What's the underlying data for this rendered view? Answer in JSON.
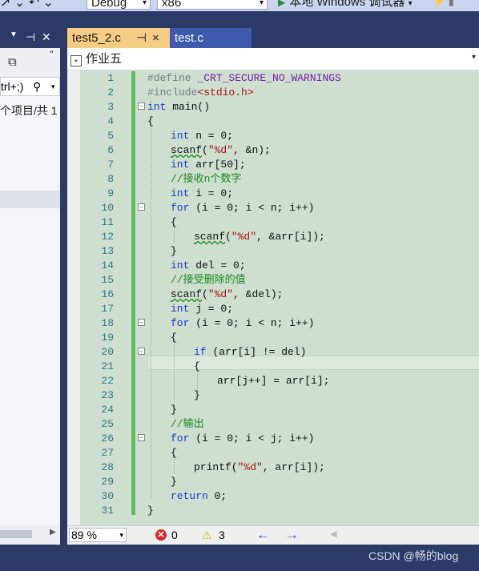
{
  "toolbar": {
    "config": "Debug",
    "platform": "x86",
    "run_label": "本地 Windows 调试器"
  },
  "left_panel": {
    "search_text": "trl+;)",
    "item_text": "个项目/共 1"
  },
  "tabs": [
    {
      "label": "test5_2.c",
      "pin": "⊣",
      "close": "×"
    },
    {
      "label": "test.c"
    }
  ],
  "nav": {
    "scope": "作业五"
  },
  "editor": {
    "line_numbers": [
      "1",
      "2",
      "3",
      "4",
      "5",
      "6",
      "7",
      "8",
      "9",
      "10",
      "11",
      "12",
      "13",
      "14",
      "15",
      "16",
      "17",
      "18",
      "19",
      "20",
      "21",
      "22",
      "23",
      "24",
      "25",
      "26",
      "27",
      "28",
      "29",
      "30",
      "31"
    ],
    "code": {
      "l1a": "#define ",
      "l1b": "_CRT_SECURE_NO_WARNINGS",
      "l2a": "#include",
      "l2b": "<stdio.h>",
      "l3a": "int",
      "l3b": " main()",
      "l4": "{",
      "l5a": "int",
      "l5b": " n = 0;",
      "l6a": "scanf",
      "l6b": "(",
      "l6c": "\"%d\"",
      "l6d": ", &n);",
      "l7a": "int",
      "l7b": " arr[50];",
      "l8": "//接收n个数字",
      "l9a": "int",
      "l9b": " i = 0;",
      "l10a": "for",
      "l10b": " (i = 0; i < n; i++)",
      "l11": "{",
      "l12a": "scanf",
      "l12b": "(",
      "l12c": "\"%d\"",
      "l12d": ", &arr[i]);",
      "l13": "}",
      "l14a": "int",
      "l14b": " del = 0;",
      "l15": "//接受删除的值",
      "l16a": "scanf",
      "l16b": "(",
      "l16c": "\"%d\"",
      "l16d": ", &del);",
      "l17a": "int",
      "l17b": " j = 0;",
      "l18a": "for",
      "l18b": " (i = 0; i < n; i++)",
      "l19": "{",
      "l20a": "if",
      "l20b": " (arr[i] != del)",
      "l21": "{",
      "l22": "arr[j++] = arr[i];",
      "l23": "}",
      "l24": "}",
      "l25": "//输出",
      "l26a": "for",
      "l26b": " (i = 0; i < j; i++)",
      "l27": "{",
      "l28a": "printf(",
      "l28b": "\"%d\"",
      "l28c": ", arr[i]);",
      "l29": "}",
      "l30a": "return",
      "l30b": " 0;",
      "l31": "}"
    }
  },
  "status": {
    "zoom": "89 %",
    "errors": "0",
    "warnings": "3"
  },
  "watermark": "CSDN @畅的blog",
  "colors": {
    "editor_bg": "#cedfd0",
    "keyword": "#1a3dd6",
    "comment": "#1c8a1c",
    "string": "#a31515",
    "active_tab": "#f5cc84",
    "change_bar": "#5cbd5c"
  }
}
